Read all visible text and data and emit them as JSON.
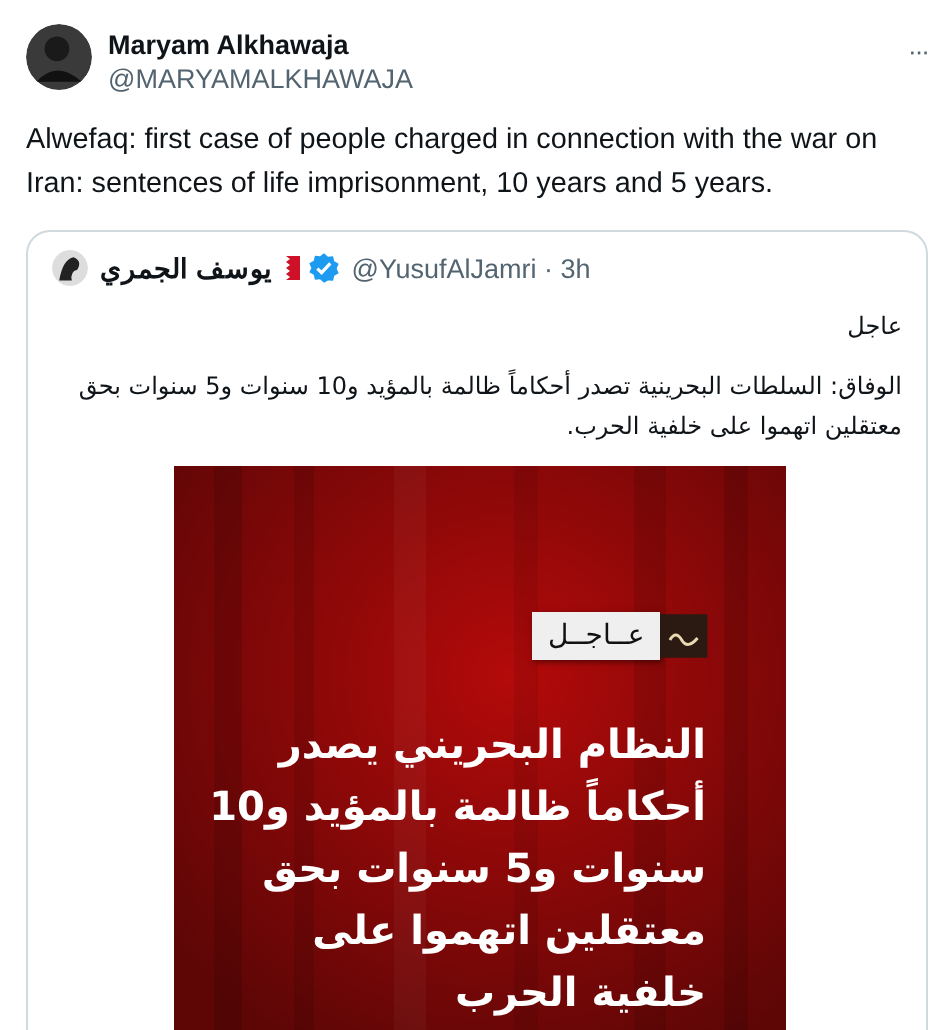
{
  "tweet": {
    "author_name": "Maryam Alkhawaja",
    "author_handle": "@MARYAMALKHAWAJA",
    "more": "···",
    "text": "Alwefaq: first case of people charged in connection with the war on Iran: sentences of life imprisonment, 10 years and 5 years."
  },
  "quoted_tweet": {
    "author_name": "يوسف الجمري",
    "verified": true,
    "handle_time": "@YusufAlJamri · 3h",
    "lines": [
      "عاجل",
      "الوفاق: السلطات البحرينية تصدر أحكاماً ظالمة بالمؤيد و10 سنوات و5 سنوات بحق معتقلين اتهموا على خلفية الحرب."
    ],
    "media": {
      "kind": "picture",
      "badge": "عــاجــل",
      "headline": [
        "النظام البحريني يصدر",
        "أحكاماً ظالمة بالمؤيد و10",
        "سنوات و5 سنوات بحق",
        "معتقلين اتهموا على",
        "خلفية الحرب"
      ]
    }
  }
}
